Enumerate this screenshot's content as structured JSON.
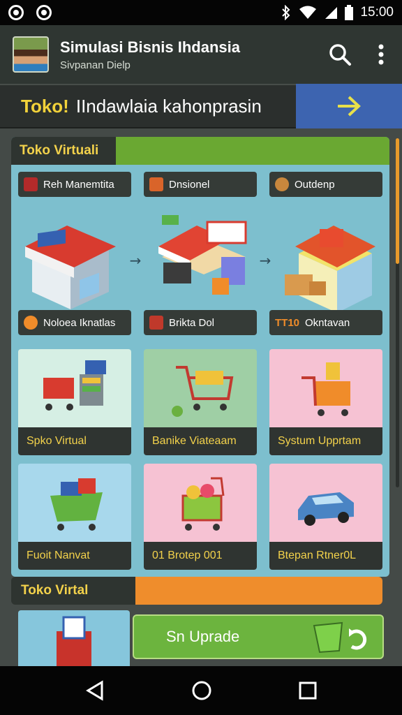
{
  "status_bar": {
    "time": "15:00",
    "icons": [
      "record-icon",
      "record-icon",
      "bluetooth-icon",
      "wifi-icon",
      "signal-icon",
      "battery-icon"
    ]
  },
  "app_bar": {
    "title": "Simulasi Bisnis  Ihdansia",
    "subtitle": "Sivpanan Dielp",
    "actions": [
      "search-icon",
      "more-vert-icon"
    ]
  },
  "banner": {
    "highlight": "Toko!",
    "text": "IIndawlaia kahonprasin"
  },
  "panel": {
    "title": "Toko Virtuali",
    "top_labels": [
      "Reh Manemtita",
      "Dnsionel",
      "Outdenp"
    ],
    "mid_labels": [
      "Noloea Iknatlas",
      "Brikta Dol",
      "Okntavan"
    ],
    "mid_label_prefix": "TT10",
    "cards_row1": [
      "Spko Virtual",
      "Banike Viateaam",
      "Systum Upprtam"
    ],
    "cards_row2": [
      "Fuoit Nanvat",
      "01 Brotep 001",
      "Btepan Rtner0L"
    ]
  },
  "section2": {
    "title": "Toko Virtal",
    "upgrade_label": "Sn Uprade"
  },
  "colors": {
    "accent_yellow": "#f3d24b",
    "green": "#6aa832",
    "orange": "#ef8d2c",
    "blue": "#3d64b0"
  }
}
